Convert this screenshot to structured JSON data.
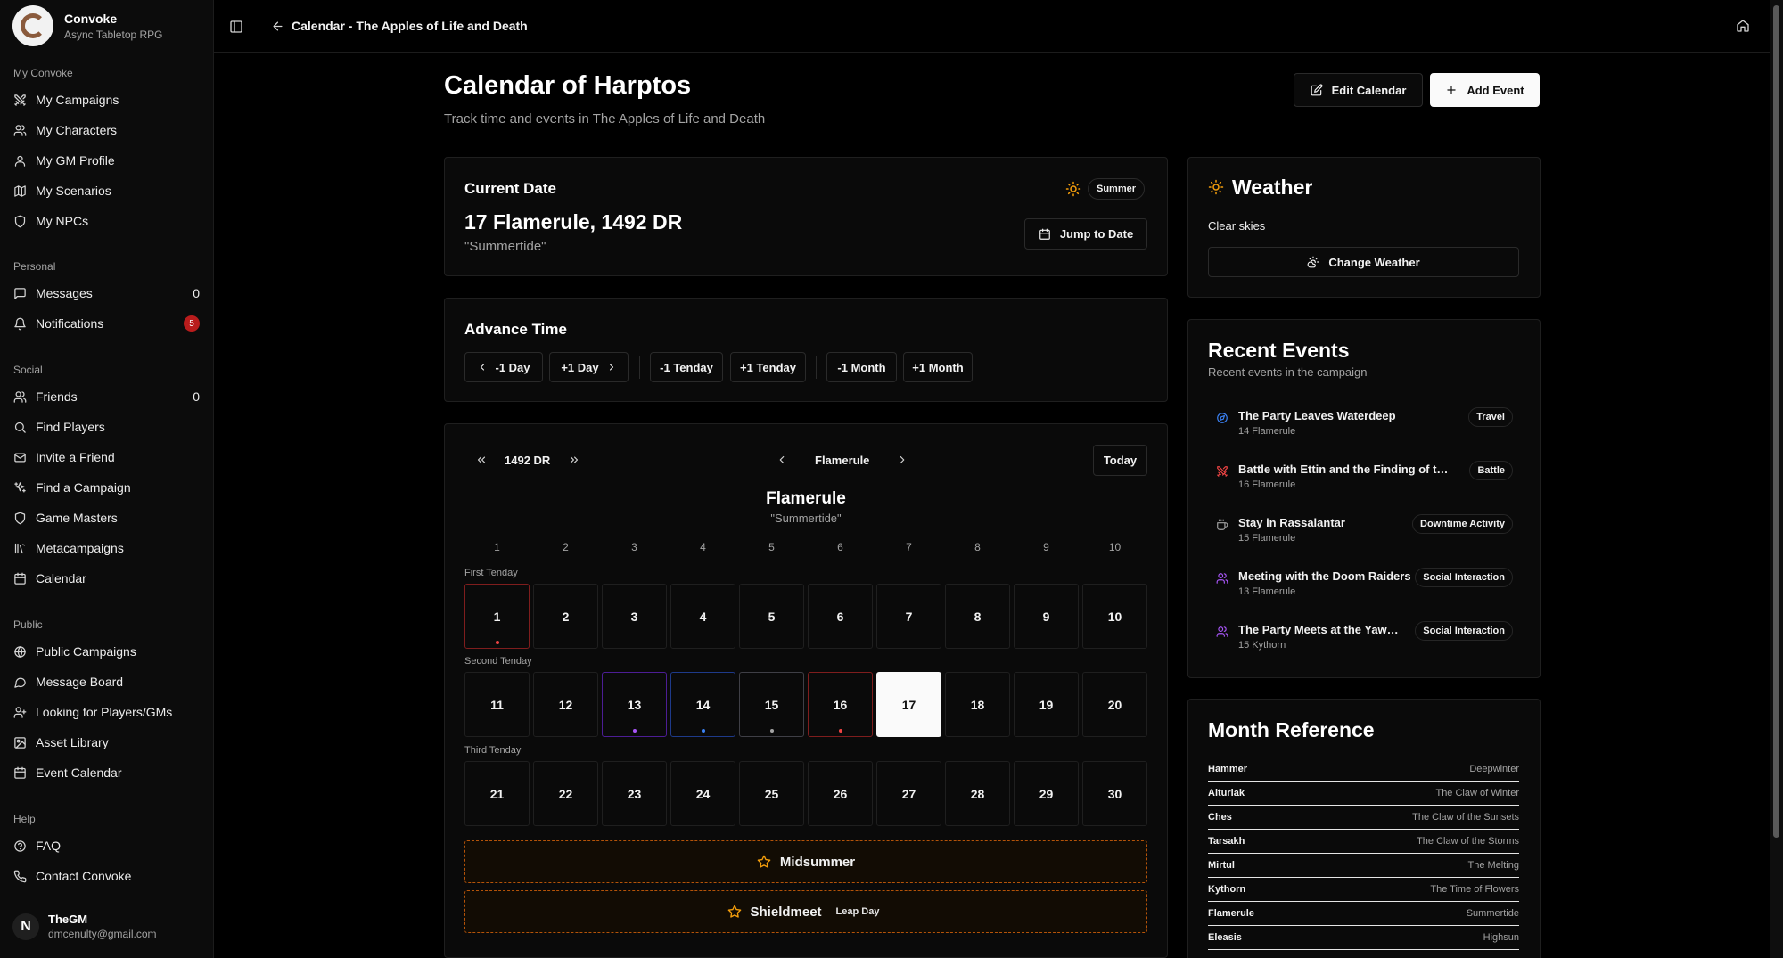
{
  "brand": {
    "name": "Convoke",
    "subtitle": "Async Tabletop RPG"
  },
  "sidebar": {
    "sections": [
      {
        "heading": "My Convoke",
        "items": [
          {
            "label": "My Campaigns",
            "icon": "swords-icon"
          },
          {
            "label": "My Characters",
            "icon": "users-icon"
          },
          {
            "label": "My GM Profile",
            "icon": "user-icon"
          },
          {
            "label": "My Scenarios",
            "icon": "map-icon"
          },
          {
            "label": "My NPCs",
            "icon": "shield-icon"
          }
        ]
      },
      {
        "heading": "Personal",
        "items": [
          {
            "label": "Messages",
            "icon": "message-icon",
            "count": "0"
          },
          {
            "label": "Notifications",
            "icon": "bell-icon",
            "badge": "5"
          }
        ]
      },
      {
        "heading": "Social",
        "items": [
          {
            "label": "Friends",
            "icon": "users-icon",
            "count": "0"
          },
          {
            "label": "Find Players",
            "icon": "search-icon"
          },
          {
            "label": "Invite a Friend",
            "icon": "mail-icon"
          },
          {
            "label": "Find a Campaign",
            "icon": "sparkles-icon"
          },
          {
            "label": "Game Masters",
            "icon": "shield-icon"
          },
          {
            "label": "Metacampaigns",
            "icon": "library-icon"
          },
          {
            "label": "Calendar",
            "icon": "calendar-icon"
          }
        ]
      },
      {
        "heading": "Public",
        "items": [
          {
            "label": "Public Campaigns",
            "icon": "globe-icon"
          },
          {
            "label": "Message Board",
            "icon": "message-icon"
          },
          {
            "label": "Looking for Players/GMs",
            "icon": "user-plus-icon"
          },
          {
            "label": "Asset Library",
            "icon": "image-icon"
          },
          {
            "label": "Event Calendar",
            "icon": "calendar-icon"
          }
        ]
      },
      {
        "heading": "Help",
        "items": [
          {
            "label": "FAQ",
            "icon": "help-circle-icon"
          },
          {
            "label": "Contact Convoke",
            "icon": "phone-icon"
          }
        ]
      }
    ]
  },
  "user": {
    "initial": "N",
    "name": "TheGM",
    "email": "dmcenulty@gmail.com"
  },
  "topbar": {
    "breadcrumb": "Calendar - The Apples of Life and Death"
  },
  "header": {
    "title": "Calendar of Harptos",
    "subtitle": "Track time and events in The Apples of Life and Death",
    "edit_label": "Edit Calendar",
    "add_label": "Add Event"
  },
  "current": {
    "heading": "Current Date",
    "season": "Summer",
    "date": "17 Flamerule, 1492 DR",
    "quote": "\"Summertide\"",
    "jump_label": "Jump to Date"
  },
  "advance": {
    "heading": "Advance Time",
    "buttons": [
      "-1 Day",
      "+1 Day",
      "-1 Tenday",
      "+1 Tenday",
      "-1 Month",
      "+1 Month"
    ]
  },
  "calendar": {
    "year": "1492 DR",
    "month": "Flamerule",
    "today_label": "Today",
    "month_title": "Flamerule",
    "month_quote": "\"Summertide\"",
    "weekdays": [
      "1",
      "2",
      "3",
      "4",
      "5",
      "6",
      "7",
      "8",
      "9",
      "10"
    ],
    "tendays": [
      {
        "label": "First Tenday",
        "days": [
          "1",
          "2",
          "3",
          "4",
          "5",
          "6",
          "7",
          "8",
          "9",
          "10"
        ]
      },
      {
        "label": "Second Tenday",
        "days": [
          "11",
          "12",
          "13",
          "14",
          "15",
          "16",
          "17",
          "18",
          "19",
          "20"
        ]
      },
      {
        "label": "Third Tenday",
        "days": [
          "21",
          "22",
          "23",
          "24",
          "25",
          "26",
          "27",
          "28",
          "29",
          "30"
        ]
      }
    ],
    "selected_day": "17",
    "festivals": [
      {
        "name": "Midsummer",
        "tag": ""
      },
      {
        "name": "Shieldmeet",
        "tag": "Leap Day"
      }
    ]
  },
  "weather": {
    "heading": "Weather",
    "condition": "Clear skies",
    "button": "Change Weather"
  },
  "recent": {
    "heading": "Recent Events",
    "subtitle": "Recent events in the campaign",
    "events": [
      {
        "title": "The Party Leaves Waterdeep",
        "date": "14 Flamerule",
        "tag": "Travel",
        "icon": "compass-icon",
        "color": "#3b82f6"
      },
      {
        "title": "Battle with Ettin and the Finding of the Druid",
        "date": "16 Flamerule",
        "tag": "Battle",
        "icon": "swords-icon",
        "color": "#ef4444"
      },
      {
        "title": "Stay in Rassalantar",
        "date": "15 Flamerule",
        "tag": "Downtime Activity",
        "icon": "coffee-icon",
        "color": "#a3a3a3"
      },
      {
        "title": "Meeting with the Doom Raiders",
        "date": "13 Flamerule",
        "tag": "Social Interaction",
        "icon": "users-icon",
        "color": "#a855f7"
      },
      {
        "title": "The Party Meets at the Yawning Portal",
        "date": "15 Kythorn",
        "tag": "Social Interaction",
        "icon": "users-icon",
        "color": "#a855f7"
      }
    ]
  },
  "months": {
    "heading": "Month Reference",
    "items": [
      {
        "name": "Hammer",
        "common": "Deepwinter"
      },
      {
        "name": "Alturiak",
        "common": "The Claw of Winter"
      },
      {
        "name": "Ches",
        "common": "The Claw of the Sunsets"
      },
      {
        "name": "Tarsakh",
        "common": "The Claw of the Storms"
      },
      {
        "name": "Mirtul",
        "common": "The Melting"
      },
      {
        "name": "Kythorn",
        "common": "The Time of Flowers"
      },
      {
        "name": "Flamerule",
        "common": "Summertide"
      },
      {
        "name": "Eleasis",
        "common": "Highsun"
      }
    ]
  },
  "colors": {
    "festival_border": "#b45309",
    "accent_star": "#f59e0b",
    "notification_badge": "#b91c1c"
  }
}
